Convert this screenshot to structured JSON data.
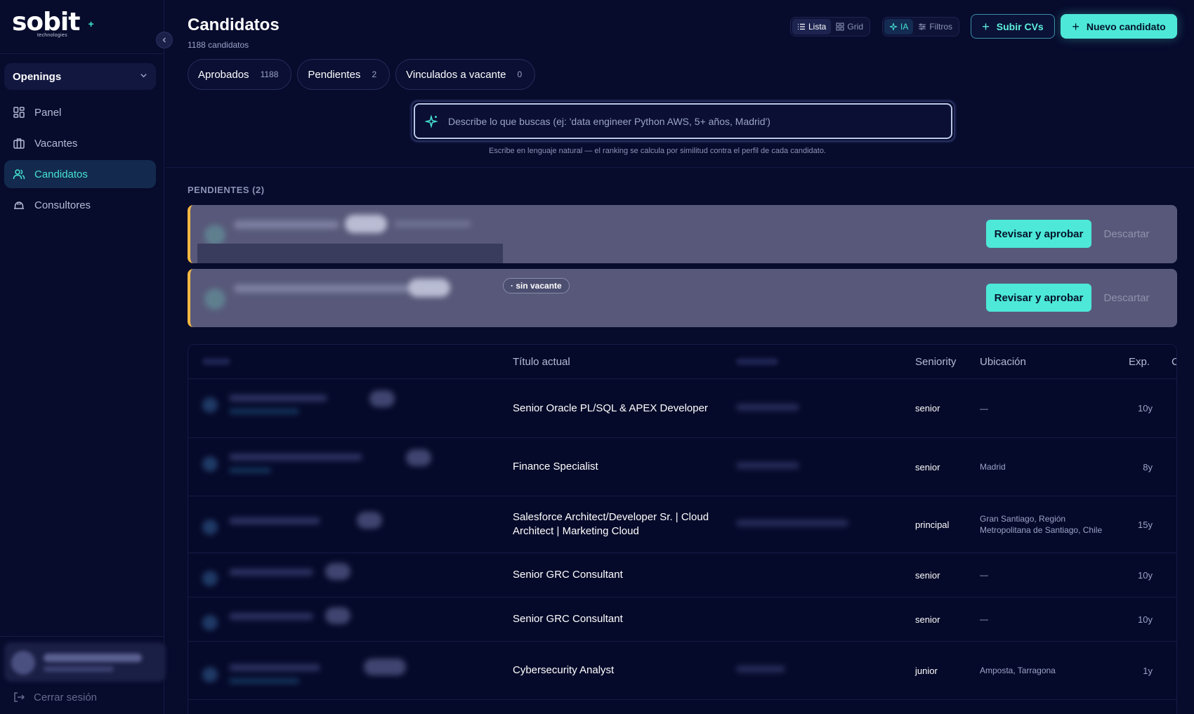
{
  "brand": {
    "logo_text": "sobit",
    "logo_sub": "technologies"
  },
  "sidebar": {
    "workspace": "Openings",
    "items": [
      {
        "label": "Panel",
        "icon": "dashboard-icon",
        "active": false
      },
      {
        "label": "Vacantes",
        "icon": "briefcase-icon",
        "active": false
      },
      {
        "label": "Candidatos",
        "icon": "users-icon",
        "active": true
      },
      {
        "label": "Consultores",
        "icon": "hard-hat-icon",
        "active": false
      }
    ],
    "logout_label": "Cerrar sesión"
  },
  "header": {
    "title": "Candidatos",
    "subtitle": "1188 candidatos",
    "view_toggles": {
      "list": "Lista",
      "grid": "Grid"
    },
    "mode_toggles": {
      "ai": "IA",
      "filters": "Filtros"
    },
    "upload_label": "Subir CVs",
    "new_label": "Nuevo candidato"
  },
  "chips": [
    {
      "label": "Aprobados",
      "count": "1188"
    },
    {
      "label": "Pendientes",
      "count": "2"
    },
    {
      "label": "Vinculados a vacante",
      "count": "0"
    }
  ],
  "search": {
    "placeholder": "Describe lo que buscas (ej: 'data engineer Python AWS, 5+ años, Madrid')",
    "hint": "Escribe en lenguaje natural — el ranking se calcula por similitud contra el perfil de cada candidato."
  },
  "pending": {
    "title": "PENDIENTES (2)",
    "approve_label": "Revisar y aprobar",
    "discard_label": "Descartar",
    "badge_no_vacancy": "· sin vacante"
  },
  "table": {
    "columns": {
      "title": "Título actual",
      "seniority": "Seniority",
      "location": "Ubicación",
      "exp": "Exp.",
      "cv": "CV"
    },
    "rows": [
      {
        "title": "Senior Oracle PL/SQL & APEX Developer",
        "seniority": "senior",
        "location": "—",
        "exp": "10y",
        "cv": true
      },
      {
        "title": "Finance Specialist",
        "seniority": "senior",
        "location": "Madrid",
        "exp": "8y",
        "cv": true
      },
      {
        "title": "Salesforce Architect/Developer Sr. | Cloud Architect | Marketing Cloud",
        "seniority": "principal",
        "location": "Gran Santiago, Región Metropolitana de Santiago, Chile",
        "exp": "15y",
        "cv": true
      },
      {
        "title": "Senior GRC Consultant",
        "seniority": "senior",
        "location": "—",
        "exp": "10y",
        "cv": false
      },
      {
        "title": "Senior GRC Consultant",
        "seniority": "senior",
        "location": "—",
        "exp": "10y",
        "cv": false
      },
      {
        "title": "Cybersecurity Analyst",
        "seniority": "junior",
        "location": "Amposta, Tarragona",
        "exp": "1y",
        "cv": true
      }
    ]
  },
  "colors": {
    "accent": "#4de8d8",
    "background": "#070b2c",
    "pending_border": "#f4b942",
    "pending_card": "#58597a"
  }
}
